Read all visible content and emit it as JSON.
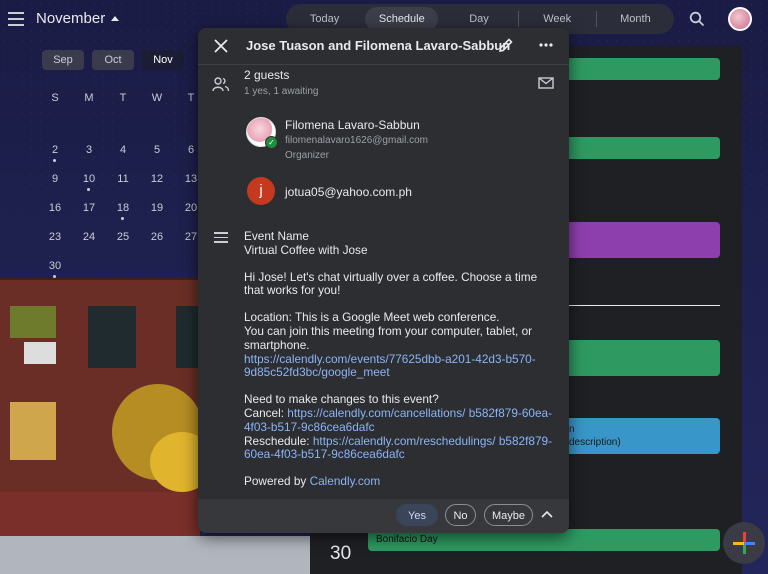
{
  "header": {
    "month": "November",
    "views": [
      "Today",
      "Schedule",
      "Day",
      "Week",
      "Month"
    ],
    "active_view": "Schedule"
  },
  "mini_calendar": {
    "months": [
      "Sep",
      "Oct",
      "Nov"
    ],
    "selected_month": "Nov",
    "weekdays": [
      "S",
      "M",
      "T",
      "W",
      "T"
    ],
    "weeks": [
      [
        "",
        "",
        "",
        "",
        ""
      ],
      [
        "2",
        "3",
        "4",
        "5",
        "6"
      ],
      [
        "9",
        "10",
        "11",
        "12",
        "13"
      ],
      [
        "16",
        "17",
        "18",
        "19",
        "20"
      ],
      [
        "23",
        "24",
        "25",
        "26",
        "27"
      ],
      [
        "30",
        "",
        "",
        "",
        ""
      ]
    ]
  },
  "schedule": {
    "events": [
      {
        "color": "#2e9a62"
      },
      {
        "color": "#2e9a62"
      },
      {
        "color": "#8e3fae"
      },
      {
        "color": "#2e9a62"
      },
      {
        "color": "#3996c9",
        "text_1": "n",
        "text_2": "description)"
      }
    ],
    "bottom_date": "30",
    "holiday": "Bonifacio Day"
  },
  "popup": {
    "title": "Jose Tuason and Filomena Lavaro-Sabbun",
    "guests_count": "2 guests",
    "guests_summary": "1 yes, 1 awaiting",
    "guests": [
      {
        "name": "Filomena Lavaro-Sabbun",
        "email": "filomenalavaro1626@gmail.com",
        "role": "Organizer"
      },
      {
        "initial": "j",
        "email": "jotua05@yahoo.com.ph"
      }
    ],
    "description": {
      "event_name_label": "Event Name",
      "event_name": "Virtual Coffee with Jose",
      "greeting": "Hi Jose! Let's chat virtually over a coffee. Choose a time that works for you!",
      "location": "Location: This is a Google Meet web conference.",
      "join": "You can join this meeting from your computer, tablet, or smartphone.",
      "meet_link": "https://calendly.com/events/77625dbb-a201-42d3-b570-9d85c52fd3bc/google_meet",
      "changes": "Need to make changes to this event?",
      "cancel_label": "Cancel: ",
      "cancel_link": "https://calendly.com/cancellations/ b582f879-60ea-4f03-b517-9c86cea6dafc",
      "reschedule_label": "Reschedule: ",
      "reschedule_link": "https://calendly.com/reschedulings/ b582f879-60ea-4f03-b517-9c86cea6dafc",
      "powered_by": "Powered by ",
      "powered_link": "Calendly.com"
    },
    "rsvp": {
      "yes": "Yes",
      "no": "No",
      "maybe": "Maybe"
    }
  }
}
